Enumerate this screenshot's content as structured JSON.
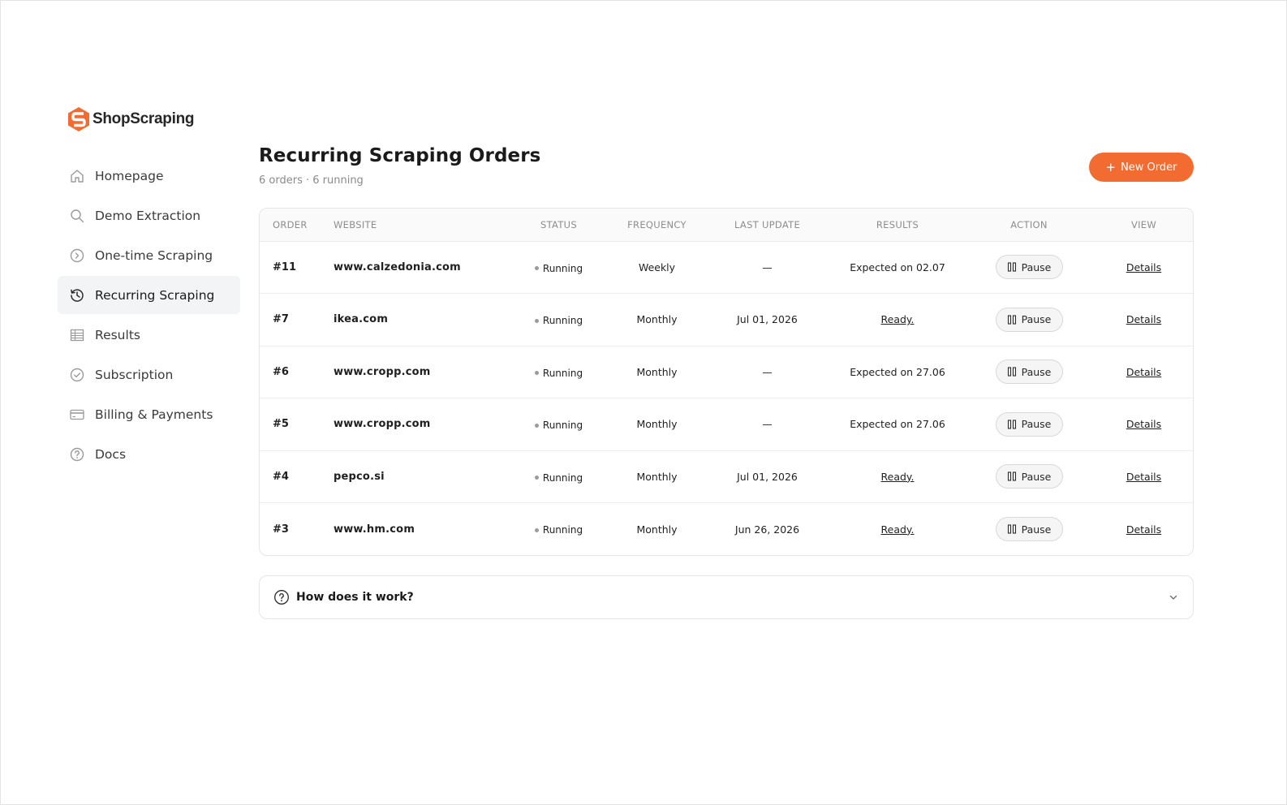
{
  "brand": {
    "name": "ShopScraping",
    "color": "#f26b30"
  },
  "sidebar": {
    "items": [
      {
        "label": "Homepage",
        "icon": "home-icon",
        "active": false
      },
      {
        "label": "Demo Extraction",
        "icon": "search-icon",
        "active": false
      },
      {
        "label": "One-time Scraping",
        "icon": "chevron-circle-icon",
        "active": false
      },
      {
        "label": "Recurring Scraping",
        "icon": "history-icon",
        "active": true
      },
      {
        "label": "Results",
        "icon": "table-icon",
        "active": false
      },
      {
        "label": "Subscription",
        "icon": "check-circle-icon",
        "active": false
      },
      {
        "label": "Billing & Payments",
        "icon": "credit-card-icon",
        "active": false
      },
      {
        "label": "Docs",
        "icon": "help-circle-icon",
        "active": false
      }
    ]
  },
  "header": {
    "title": "Recurring Scraping Orders",
    "subtitle": "6 orders · 6 running",
    "new_order_label": "New Order"
  },
  "table": {
    "columns": [
      "Order",
      "Website",
      "Status",
      "Frequency",
      "Last update",
      "Results",
      "Action",
      "View"
    ],
    "rows": [
      {
        "order": "#11",
        "website": "www.calzedonia.com",
        "status": "Running",
        "frequency": "Weekly",
        "last_update": "—",
        "results": "Expected on 02.07",
        "results_ready": false,
        "action": "Pause",
        "view": "Details"
      },
      {
        "order": "#7",
        "website": "ikea.com",
        "status": "Running",
        "frequency": "Monthly",
        "last_update": "Jul 01, 2026",
        "results": "Ready.",
        "results_ready": true,
        "action": "Pause",
        "view": "Details"
      },
      {
        "order": "#6",
        "website": "www.cropp.com",
        "status": "Running",
        "frequency": "Monthly",
        "last_update": "—",
        "results": "Expected on 27.06",
        "results_ready": false,
        "action": "Pause",
        "view": "Details"
      },
      {
        "order": "#5",
        "website": "www.cropp.com",
        "status": "Running",
        "frequency": "Monthly",
        "last_update": "—",
        "results": "Expected on 27.06",
        "results_ready": false,
        "action": "Pause",
        "view": "Details"
      },
      {
        "order": "#4",
        "website": "pepco.si",
        "status": "Running",
        "frequency": "Monthly",
        "last_update": "Jul 01, 2026",
        "results": "Ready.",
        "results_ready": true,
        "action": "Pause",
        "view": "Details"
      },
      {
        "order": "#3",
        "website": "www.hm.com",
        "status": "Running",
        "frequency": "Monthly",
        "last_update": "Jun 26, 2026",
        "results": "Ready.",
        "results_ready": true,
        "action": "Pause",
        "view": "Details"
      }
    ]
  },
  "faq": {
    "title": "How does it work?",
    "icon": "help-circle-icon"
  }
}
